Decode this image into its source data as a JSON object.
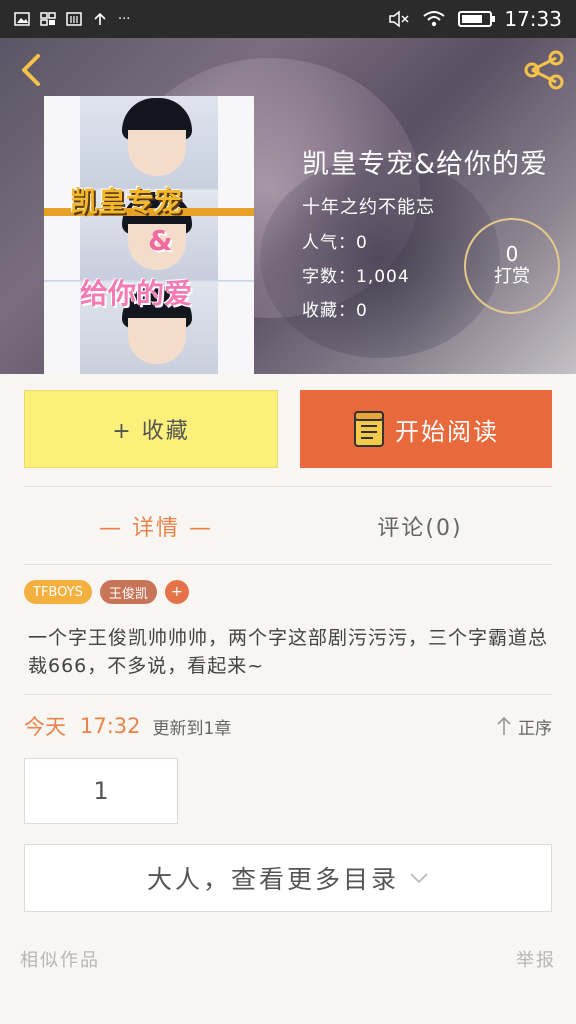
{
  "status_bar": {
    "time": "17:33",
    "left_icons": [
      "image-icon",
      "grid-icon",
      "app-icon",
      "upload-arrow-icon",
      "more-dots-icon"
    ],
    "right_icons": [
      "mute-icon",
      "wifi-icon",
      "battery-icon"
    ],
    "more_text": "···",
    "battery_level": 0.75
  },
  "header": {
    "back_icon": "chevron-left-icon",
    "share_icon": "share-icon"
  },
  "cover": {
    "title_line1": "凯皇专宠",
    "amp": "&",
    "title_line2": "给你的爱"
  },
  "book": {
    "title": "凯皇专宠&给你的爱",
    "subtitle": "十年之约不能忘",
    "popularity": "人气：0",
    "word_count": "字数：1,004",
    "favorites": "收藏：0",
    "tip_count": "0",
    "tip_label": "打赏"
  },
  "actions": {
    "collect_label": "+ 收藏",
    "read_label": "开始阅读"
  },
  "tabs": {
    "details": "— 详情 —",
    "comments": "评论(0)"
  },
  "tags": [
    "TFBOYS",
    "王俊凯",
    "+"
  ],
  "description": "一个字王俊凯帅帅帅，两个字这部剧污污污，三个字霸道总裁666，不多说，看起来~",
  "update": {
    "day": "今天",
    "time": "17:32",
    "text": "更新到1章",
    "sort_label": "正序"
  },
  "chapters": [
    "1"
  ],
  "more_catalog": "大人，查看更多目录",
  "footer": {
    "similar": "相似作品",
    "report": "举报"
  },
  "colors": {
    "accent": "#e8844a",
    "read_button": "#e86a3c",
    "collect_button": "#fbf07a",
    "tip_ring": "#e3c98a",
    "share_icon": "#f5c24a"
  }
}
